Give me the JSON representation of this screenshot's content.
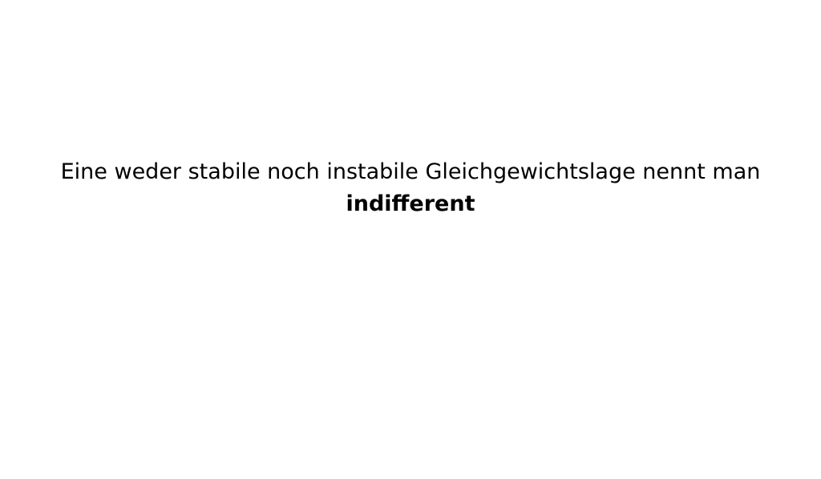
{
  "card": {
    "sentence": "Eine weder stabile noch instabile Gleichgewichtslage nennt man",
    "term": "indifferent"
  },
  "colors": {
    "background": "#ffffff",
    "text": "#000000"
  }
}
